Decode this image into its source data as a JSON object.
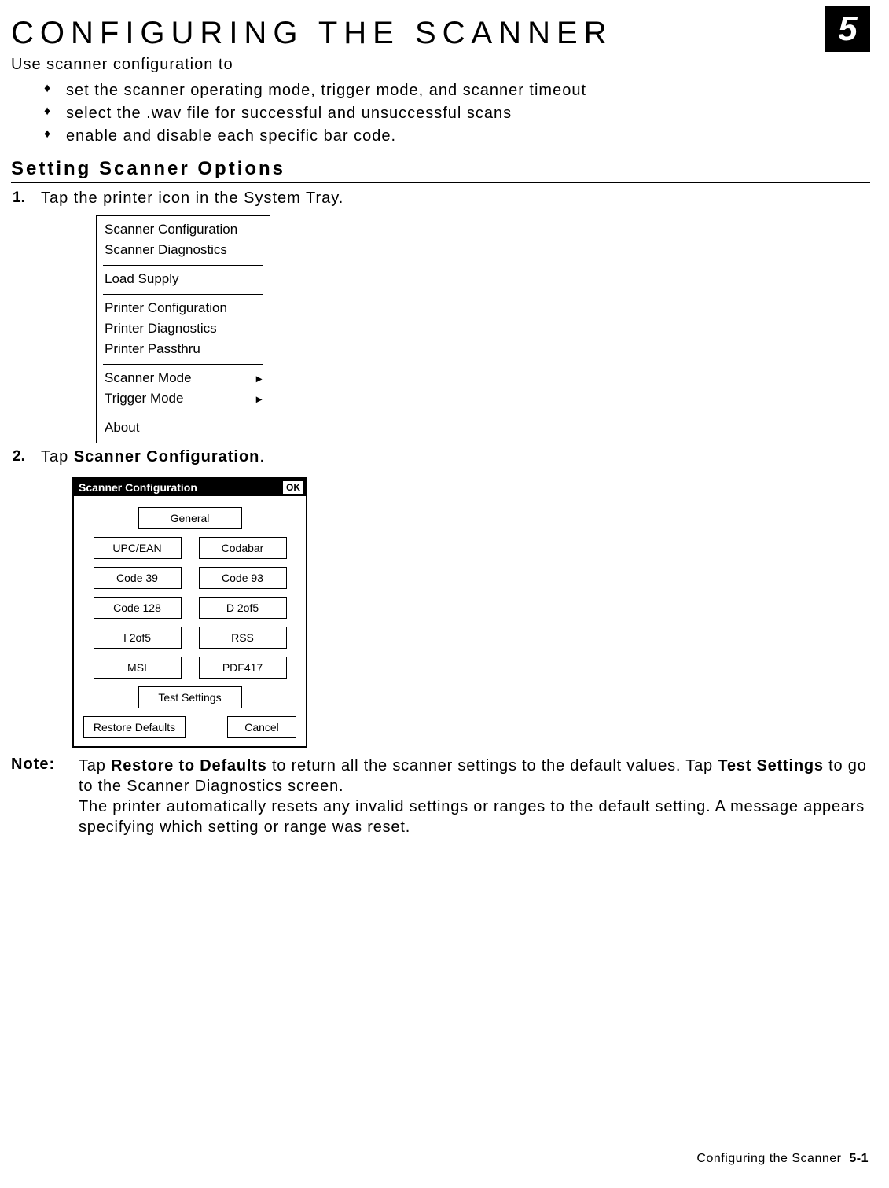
{
  "chapter_number": "5",
  "title": "CONFIGURING THE SCANNER",
  "lead": "Use scanner configuration to",
  "bullets": [
    "set the scanner operating mode, trigger mode, and scanner timeout",
    "select the .wav file for successful and unsuccessful scans",
    "enable and disable each specific bar code."
  ],
  "section_heading": "Setting Scanner Options",
  "steps": {
    "s1_num": "1.",
    "s1_text": "Tap the printer icon in the System Tray.",
    "s2_num": "2.",
    "s2_pre": "Tap ",
    "s2_bold": "Scanner Configuration",
    "s2_post": "."
  },
  "menu": {
    "g1": [
      "Scanner Configuration",
      "Scanner Diagnostics"
    ],
    "g2": [
      "Load Supply"
    ],
    "g3": [
      "Printer Configuration",
      "Printer Diagnostics",
      "Printer Passthru"
    ],
    "g4": [
      {
        "label": "Scanner Mode",
        "submenu": true
      },
      {
        "label": "Trigger Mode",
        "submenu": true
      }
    ],
    "g5": [
      "About"
    ]
  },
  "dialog": {
    "title": "Scanner Configuration",
    "ok": "OK",
    "general": "General",
    "grid": [
      [
        "UPC/EAN",
        "Codabar"
      ],
      [
        "Code 39",
        "Code 93"
      ],
      [
        "Code 128",
        "D 2of5"
      ],
      [
        "I 2of5",
        "RSS"
      ],
      [
        "MSI",
        "PDF417"
      ]
    ],
    "test": "Test Settings",
    "restore": "Restore Defaults",
    "cancel": "Cancel"
  },
  "note": {
    "label": "Note:",
    "p1_pre": "Tap ",
    "p1_b1": "Restore to Defaults",
    "p1_mid": " to return all the scanner settings to the default values. Tap ",
    "p1_b2": "Test Settings",
    "p1_post": " to go to the Scanner Diagnostics screen.",
    "p2": "The printer automatically resets any invalid settings or ranges to the default setting. A message appears specifying which setting or range was reset."
  },
  "footer": {
    "section": "Configuring the Scanner",
    "page": "5-1"
  }
}
